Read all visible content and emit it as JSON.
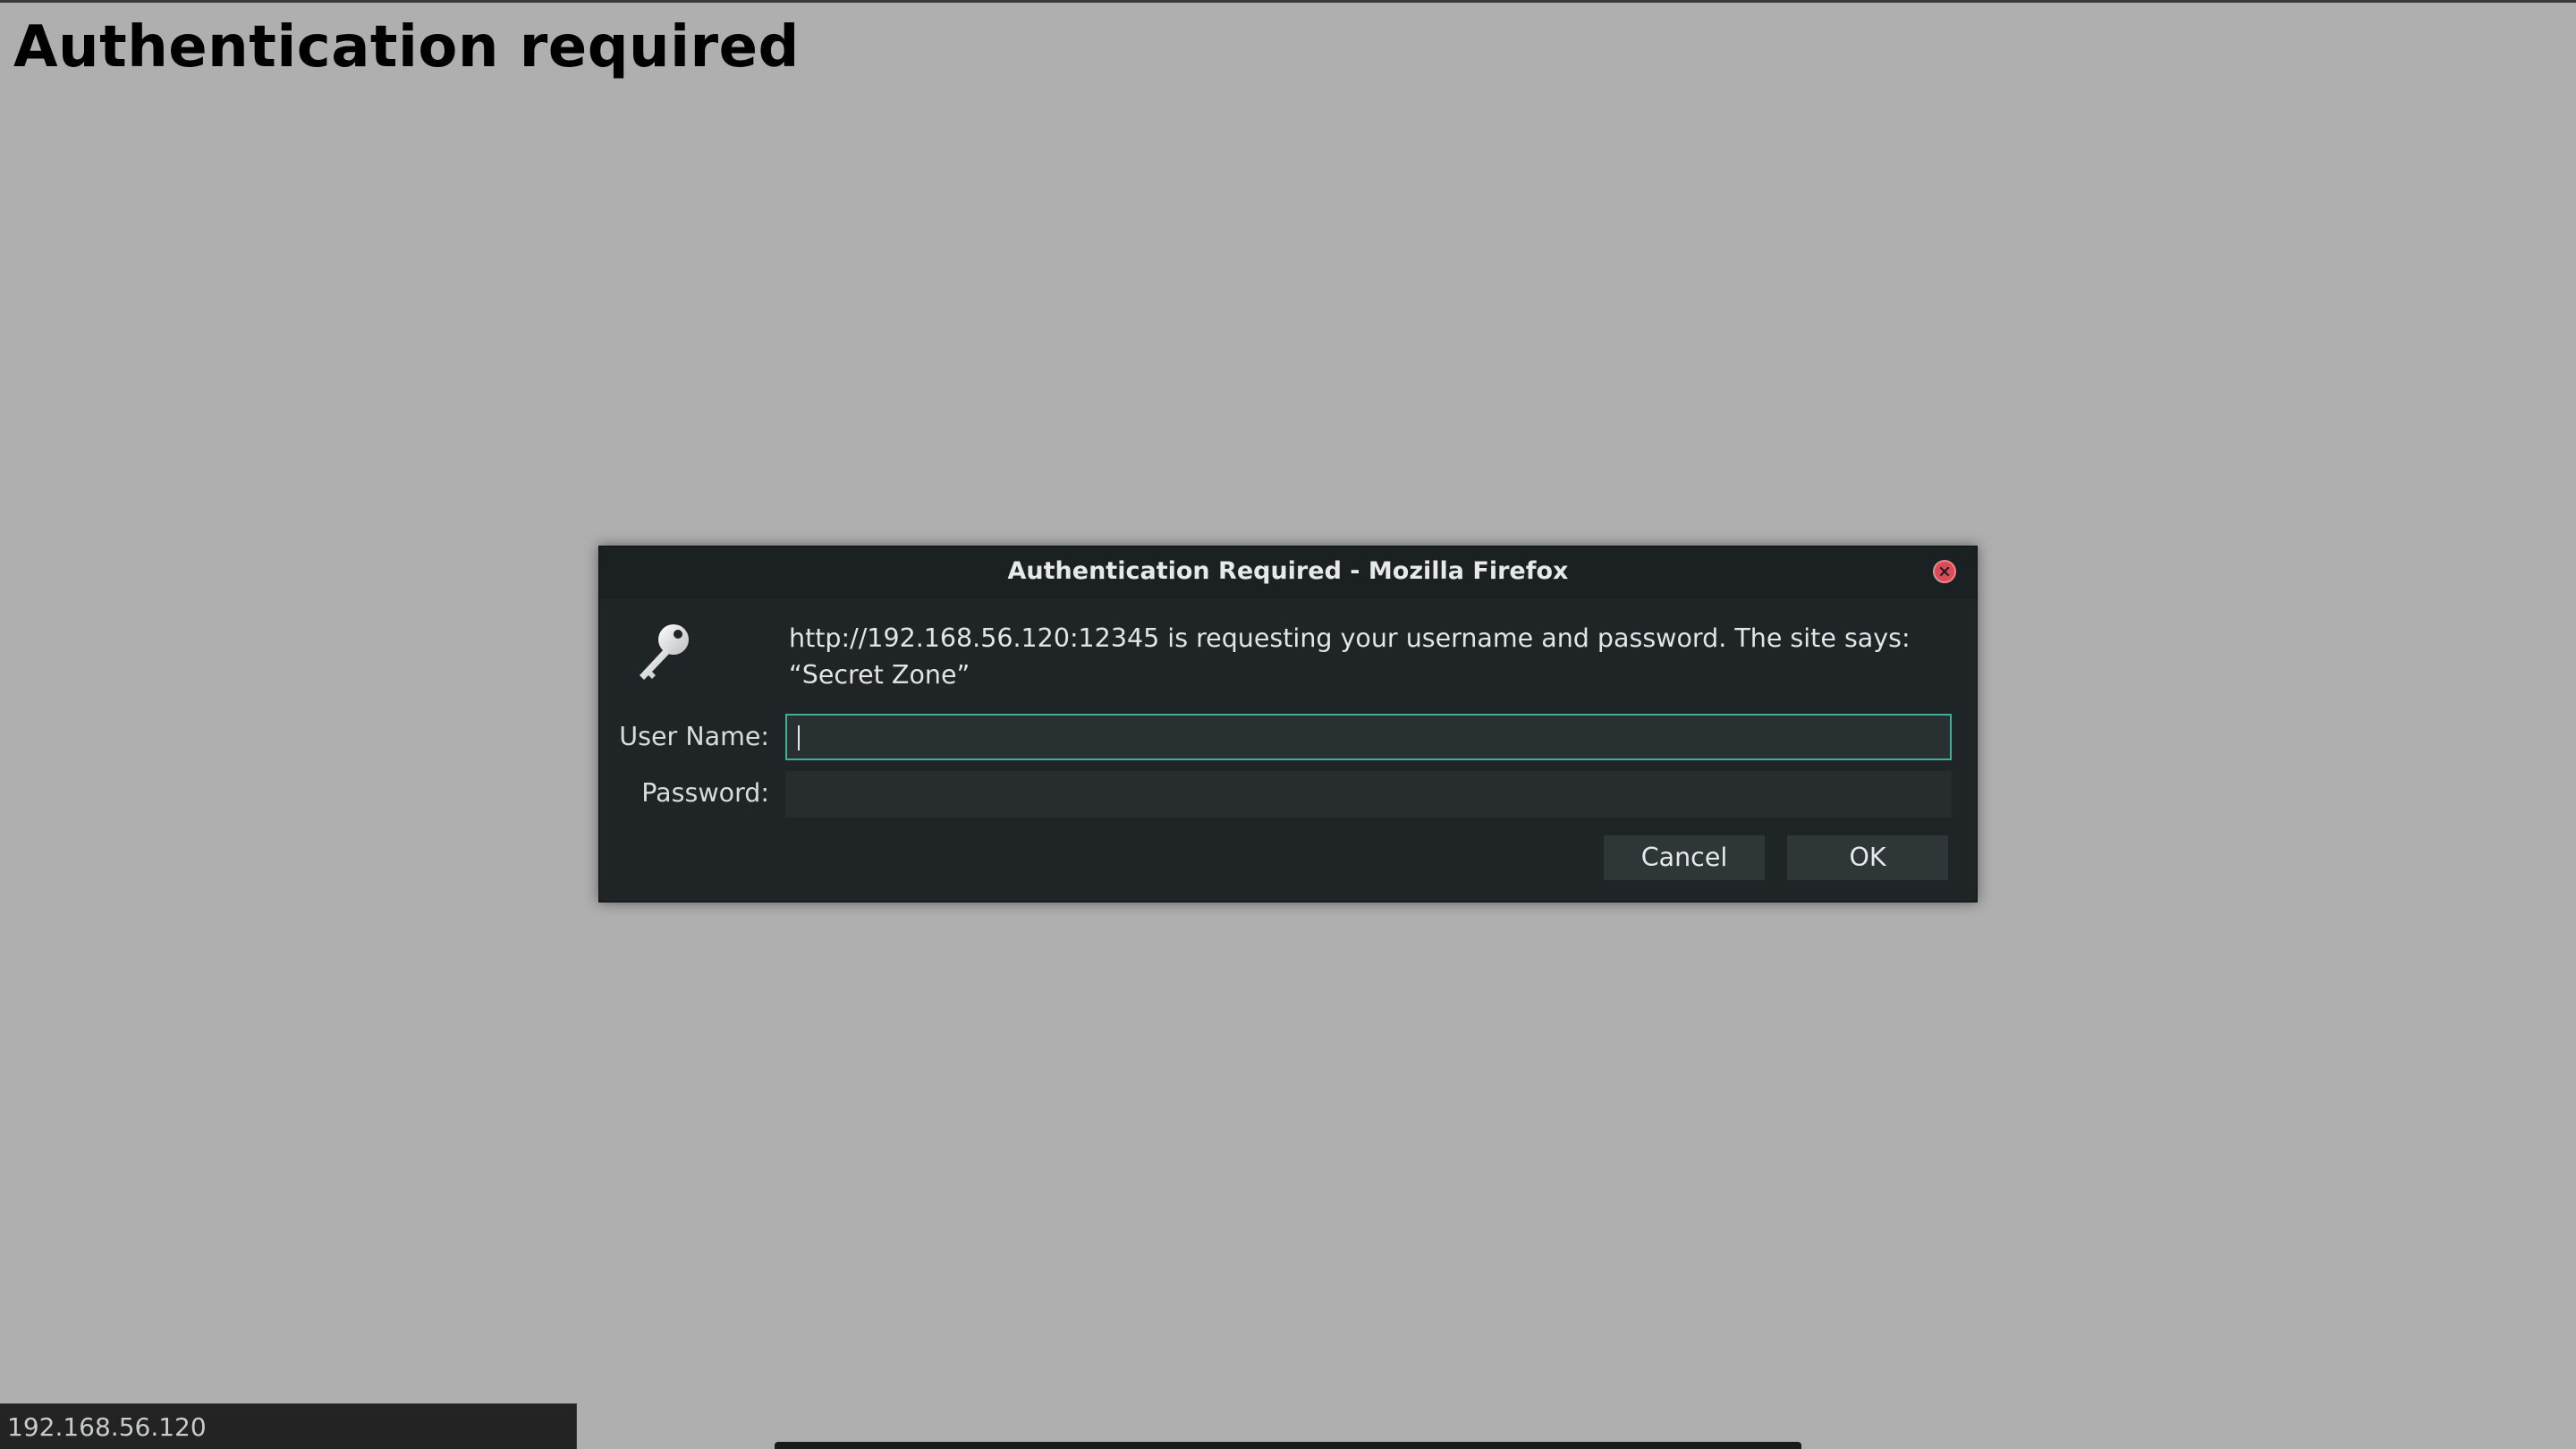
{
  "page": {
    "heading": "Authentication required"
  },
  "dialog": {
    "title": "Authentication Required - Mozilla Firefox",
    "message": "http://192.168.56.120:12345 is requesting your username and password. The site says: “Secret Zone”",
    "icon": "key-icon",
    "username": {
      "label": "User Name:",
      "value": ""
    },
    "password": {
      "label": "Password:",
      "value": ""
    },
    "buttons": {
      "cancel": "Cancel",
      "ok": "OK"
    },
    "close_icon": "close-icon"
  },
  "statusbar": {
    "text": "192.168.56.120"
  },
  "colors": {
    "page_background": "#afafaf",
    "dialog_background": "#1f2426",
    "focus_accent": "#3fae9a",
    "close_button": "#d94c55"
  }
}
